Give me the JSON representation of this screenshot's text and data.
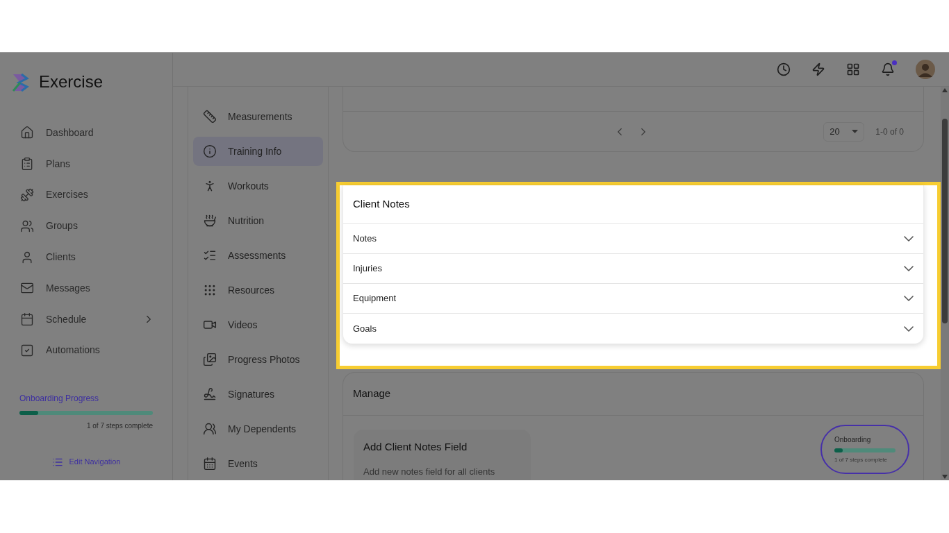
{
  "app": {
    "name": "Exercise"
  },
  "header": {
    "notifications_unread": true
  },
  "sidebar": {
    "items": [
      {
        "label": "Dashboard",
        "has_submenu": false
      },
      {
        "label": "Plans",
        "has_submenu": false
      },
      {
        "label": "Exercises",
        "has_submenu": false
      },
      {
        "label": "Groups",
        "has_submenu": false
      },
      {
        "label": "Clients",
        "has_submenu": false
      },
      {
        "label": "Messages",
        "has_submenu": false
      },
      {
        "label": "Schedule",
        "has_submenu": true
      },
      {
        "label": "Automations",
        "has_submenu": false
      }
    ],
    "onboarding": {
      "title": "Onboarding Progress",
      "level": 0.14,
      "caption": "1 of 7 steps complete"
    },
    "edit_navigation": "Edit Navigation"
  },
  "subnav": {
    "items": [
      {
        "label": "Measurements",
        "selected": false
      },
      {
        "label": "Training Info",
        "selected": true
      },
      {
        "label": "Workouts",
        "selected": false
      },
      {
        "label": "Nutrition",
        "selected": false
      },
      {
        "label": "Assessments",
        "selected": false
      },
      {
        "label": "Resources",
        "selected": false
      },
      {
        "label": "Videos",
        "selected": false
      },
      {
        "label": "Progress Photos",
        "selected": false
      },
      {
        "label": "Signatures",
        "selected": false
      },
      {
        "label": "My Dependents",
        "selected": false
      },
      {
        "label": "Events",
        "selected": false
      }
    ]
  },
  "pagination": {
    "page_size": "20",
    "range": "1-0 of 0"
  },
  "client_notes": {
    "title": "Client Notes",
    "sections": [
      {
        "label": "Notes",
        "expanded": false
      },
      {
        "label": "Injuries",
        "expanded": false
      },
      {
        "label": "Equipment",
        "expanded": false
      },
      {
        "label": "Goals",
        "expanded": false
      }
    ]
  },
  "manage": {
    "title": "Manage",
    "cards": [
      {
        "title": "Add Client Notes Field",
        "description": "Add new notes field for all clients"
      }
    ]
  },
  "onboarding_badge": {
    "title": "Onboarding",
    "level": 0.14,
    "caption": "1 of 7 steps complete"
  }
}
